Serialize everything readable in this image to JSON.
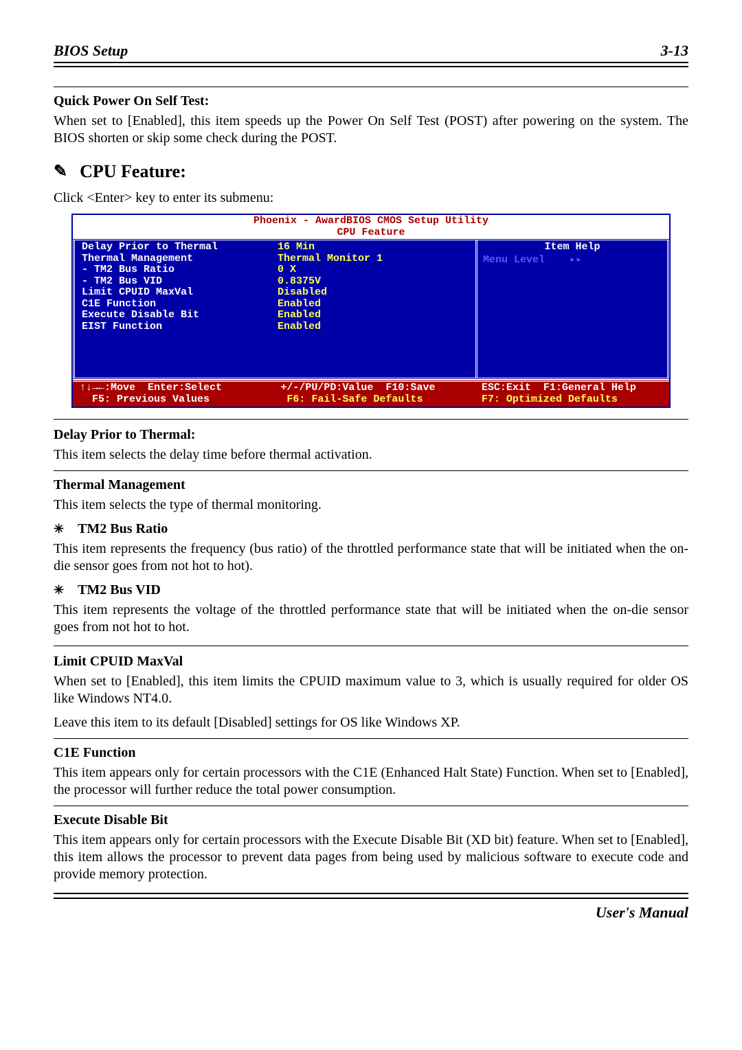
{
  "header": {
    "left": "BIOS Setup",
    "right": "3-13"
  },
  "s1": {
    "h": "Quick Power On Self Test:",
    "p": "When set to [Enabled], this item speeds up the Power On Self Test (POST) after powering on the system. The BIOS shorten or skip some check during the POST."
  },
  "cpu": {
    "title": "CPU Feature:",
    "intro": "Click <Enter> key to enter its submenu:"
  },
  "bios": {
    "title1": "Phoenix - AwardBIOS CMOS Setup Utility",
    "title2": "CPU Feature",
    "labels": "Delay Prior to Thermal\nThermal Management\n- TM2 Bus Ratio\n- TM2 Bus VID\nLimit CPUID MaxVal\nC1E Function\nExecute Disable Bit\nEIST Function",
    "vals": "16 Min\nThermal Monitor 1\n0 X\n0.8375V\nDisabled\nEnabled\nEnabled\nEnabled",
    "itemhelp": "Item Help",
    "menulevel": "Menu Level    ▸▸",
    "foot1a": "↑↓→←:Move  Enter:Select",
    "foot1b": "  F5: Previous Values",
    "foot2a": "+/-/PU/PD:Value  F10:Save",
    "foot2b": " F6: Fail-Safe Defaults",
    "foot3a": "ESC:Exit  F1:General Help",
    "foot3b": "F7: Optimized Defaults"
  },
  "d1": {
    "h": "Delay Prior to Thermal:",
    "p": "This item selects the delay time before thermal activation."
  },
  "d2": {
    "h": "Thermal Management",
    "p": "This item selects the type of thermal monitoring."
  },
  "d3": {
    "h": "TM2 Bus Ratio",
    "p": "This item represents the frequency (bus ratio) of the throttled performance state that will be initiated when the on-die sensor goes from not hot to hot)."
  },
  "d4": {
    "h": "TM2 Bus VID",
    "p": "This item represents the voltage of the throttled performance state that will be initiated when the on-die sensor goes from not hot to hot."
  },
  "d5": {
    "h": "Limit CPUID MaxVal",
    "p1": "When set to [Enabled], this item limits the CPUID maximum value to 3, which is usually required for older OS like Windows NT4.0.",
    "p2": "Leave this item to its default [Disabled] settings for OS like Windows XP."
  },
  "d6": {
    "h": "C1E Function",
    "p": "This item appears only for certain processors with the C1E (Enhanced Halt State) Function. When set to [Enabled], the processor will further reduce the total power consumption."
  },
  "d7": {
    "h": "Execute Disable Bit",
    "p": "This item appears only for certain processors with the Execute Disable Bit (XD bit) feature. When set to [Enabled], this item allows the processor to prevent data pages from being used by malicious software to execute code and provide memory protection."
  },
  "footer": "User's Manual"
}
